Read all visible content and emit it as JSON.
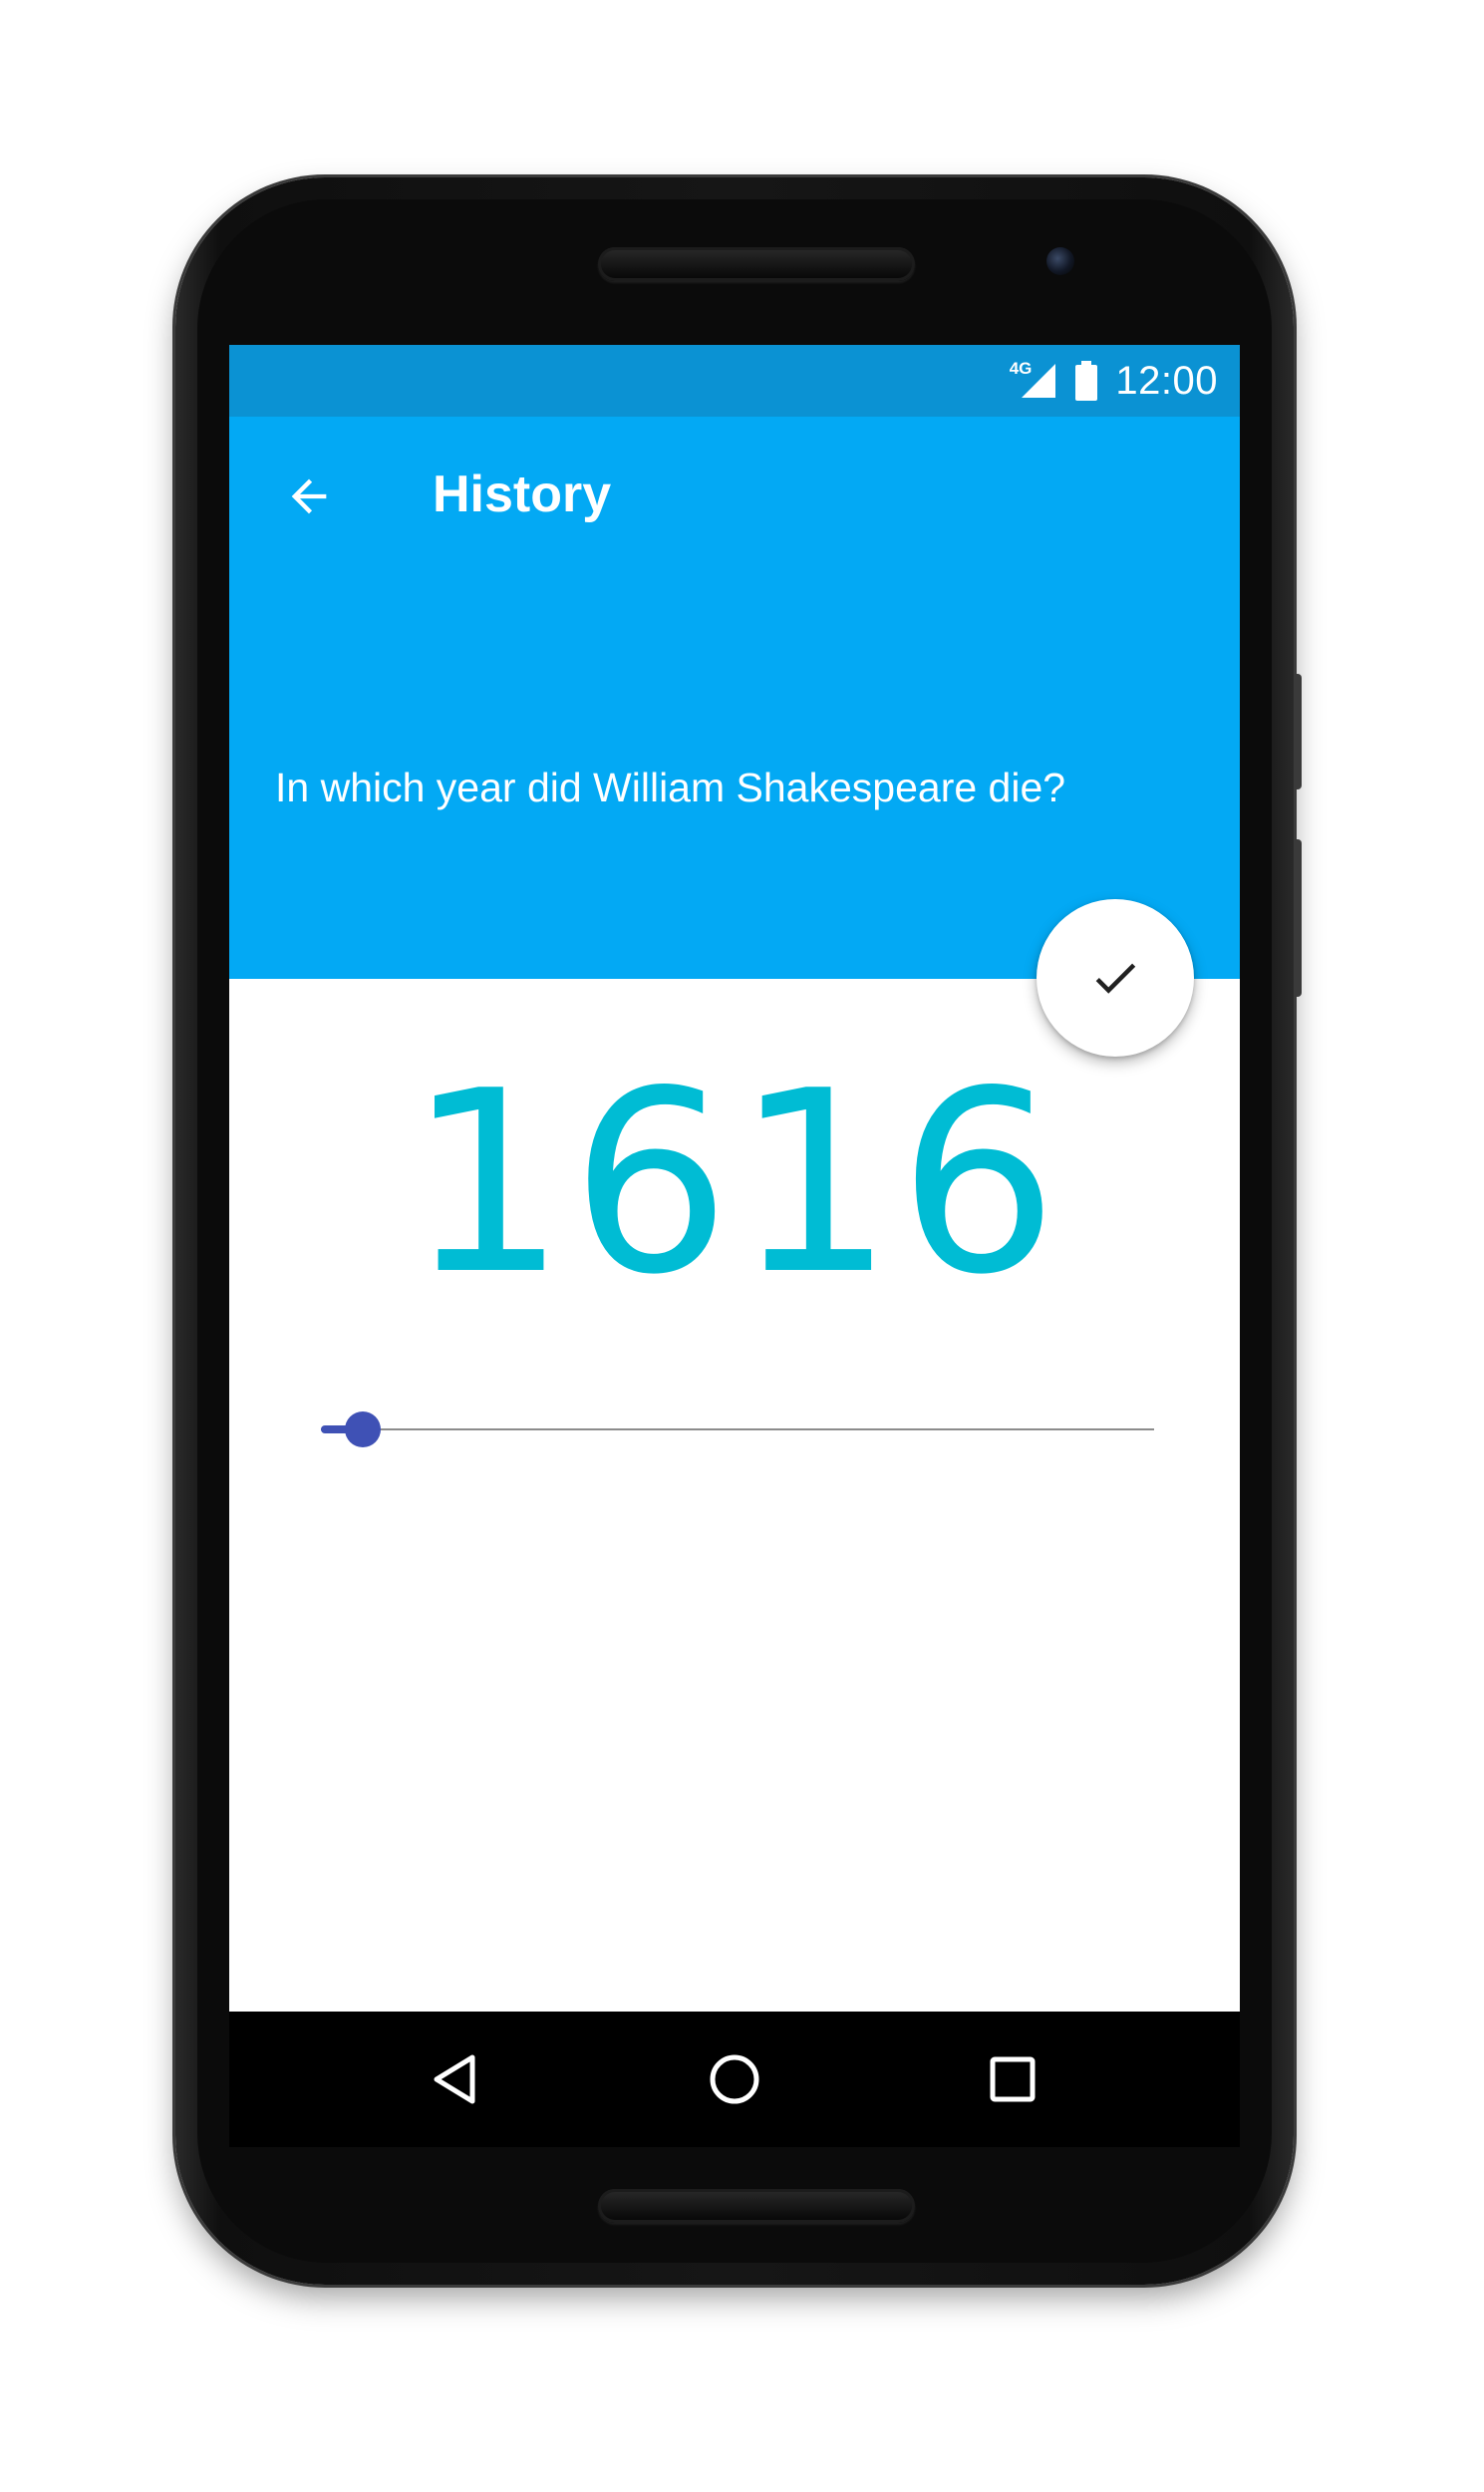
{
  "status_bar": {
    "network": "4G",
    "time": "12:00"
  },
  "header": {
    "title": "History",
    "back_icon": "arrow-back-icon",
    "question": "In which year did William Shakespeare die?"
  },
  "answer": {
    "value": "1616",
    "confirm_icon": "check-icon"
  },
  "slider": {
    "level_fraction": 0.05
  },
  "nav_bar": {
    "icons": [
      "back-triangle-icon",
      "home-circle-icon",
      "recents-square-icon"
    ]
  },
  "colors": {
    "status_bar": "#0b92d3",
    "primary": "#03a9f4",
    "answer_text": "#00bcd4",
    "slider": "#3f51b5"
  }
}
